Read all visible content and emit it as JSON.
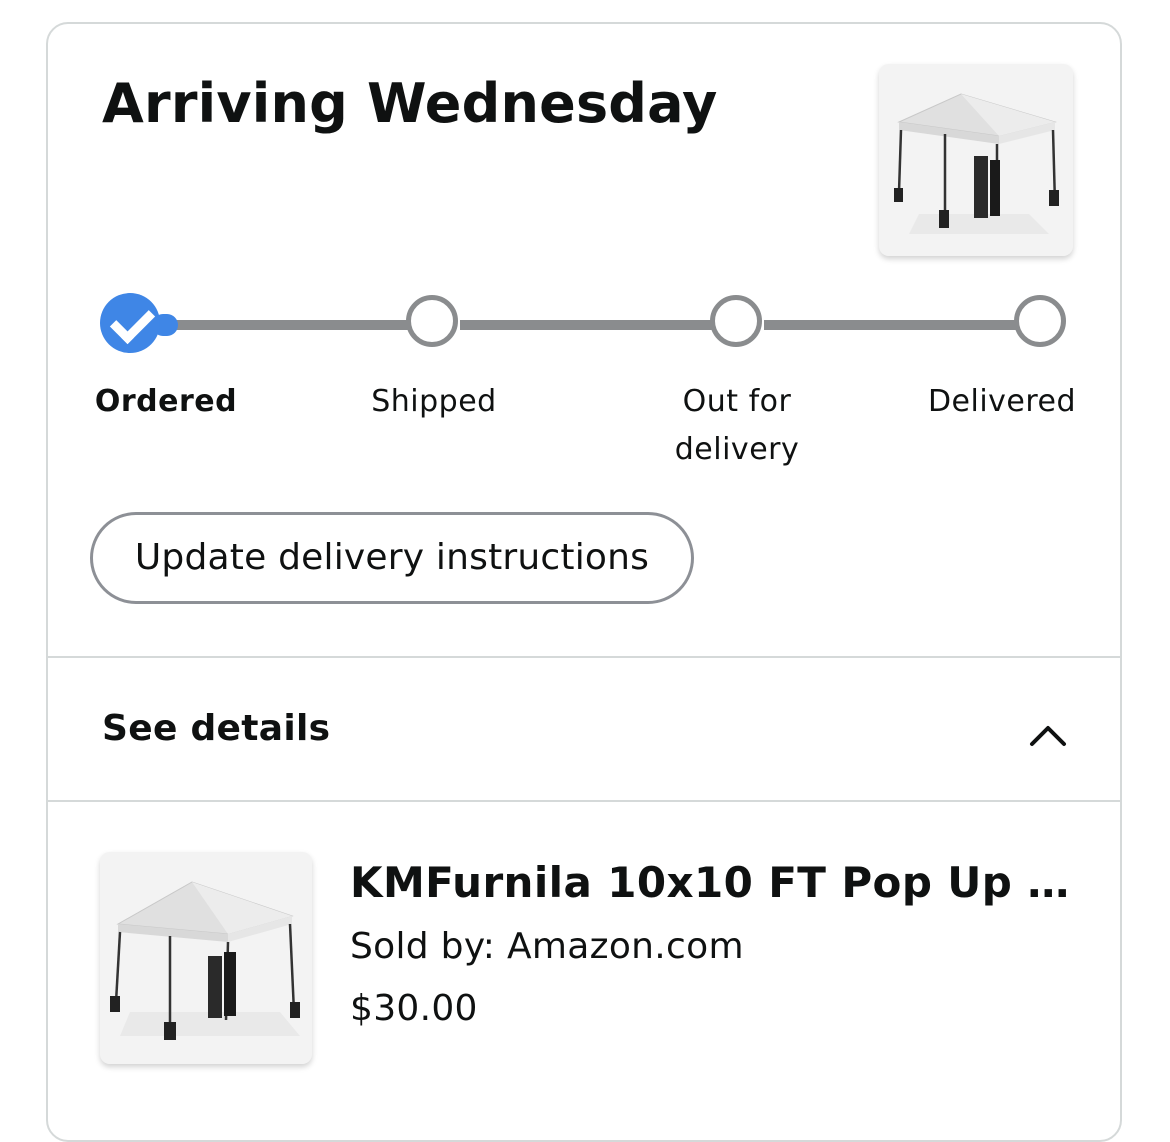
{
  "delivery": {
    "status_title": "Arriving Wednesday"
  },
  "tracker": {
    "current_step": 1,
    "steps": [
      {
        "line1": "Ordered",
        "line2": ""
      },
      {
        "line1": "Shipped",
        "line2": ""
      },
      {
        "line1": "Out for",
        "line2": "delivery"
      },
      {
        "line1": "Delivered",
        "line2": ""
      }
    ]
  },
  "actions": {
    "update_instructions_label": "Update delivery instructions"
  },
  "details": {
    "label": "See details",
    "expanded": true
  },
  "item": {
    "title": "KMFurnila 10x10 FT Pop Up C...",
    "seller": "Sold by: Amazon.com",
    "price": "$30.00"
  },
  "colors": {
    "accent": "#3f86e6",
    "track": "#8a8c8e",
    "text": "#0f1111",
    "border": "#d5d9d9"
  },
  "icons": {
    "completed_step": "checkmark-icon",
    "collapse": "chevron-up-icon",
    "product": "canopy-tent-image"
  }
}
